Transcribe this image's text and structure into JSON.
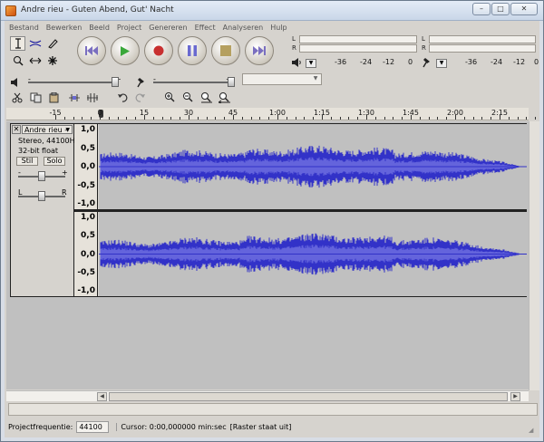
{
  "window": {
    "title": "Andre rieu - Guten Abend, Gut' Nacht",
    "buttons": {
      "minimize": "–",
      "maximize": "□",
      "close": "✕"
    }
  },
  "menu": [
    "Bestand",
    "Bewerken",
    "Beeld",
    "Project",
    "Genereren",
    "Effect",
    "Analyseren",
    "Hulp"
  ],
  "tools": [
    "selection-tool",
    "envelope-tool",
    "draw-tool",
    "zoom-tool",
    "timeshift-tool",
    "multi-tool"
  ],
  "transport": [
    "skip-to-start",
    "play",
    "record",
    "pause",
    "stop",
    "skip-to-end"
  ],
  "meters": {
    "play_l": "L",
    "play_r": "R",
    "rec_l": "L",
    "rec_r": "R",
    "scale_left": [
      "-36",
      "-24",
      "-12",
      "0"
    ],
    "scale_right": [
      "-36",
      "-24",
      "-12",
      "0"
    ]
  },
  "mixer": {
    "output_minus": "-",
    "output_plus": "+",
    "input_minus": "-",
    "input_plus": "+",
    "input_source": ""
  },
  "ruler": {
    "labels": [
      "-15",
      "0",
      "15",
      "30",
      "45",
      "1:00",
      "1:15",
      "1:30",
      "1:45",
      "2:00",
      "2:15"
    ]
  },
  "track": {
    "name": "Andre rieu -",
    "info_line1": "Stereo, 44100Hz",
    "info_line2": "32-bit float",
    "mute": "Stil",
    "solo": "Solo",
    "gain_minus": "-",
    "gain_plus": "+",
    "pan_left": "L",
    "pan_right": "R",
    "scale": [
      "1,0",
      "0,5",
      "0,0",
      "-0,5",
      "-1,0"
    ],
    "wave_color": "#3232c8",
    "wave_light": "#6464dc"
  },
  "status": {
    "project_rate_label": "Projectfrequentie:",
    "project_rate": "44100",
    "cursor": "Cursor: 0:00,000000 min:sec",
    "snap": "[Raster staat uit]"
  }
}
